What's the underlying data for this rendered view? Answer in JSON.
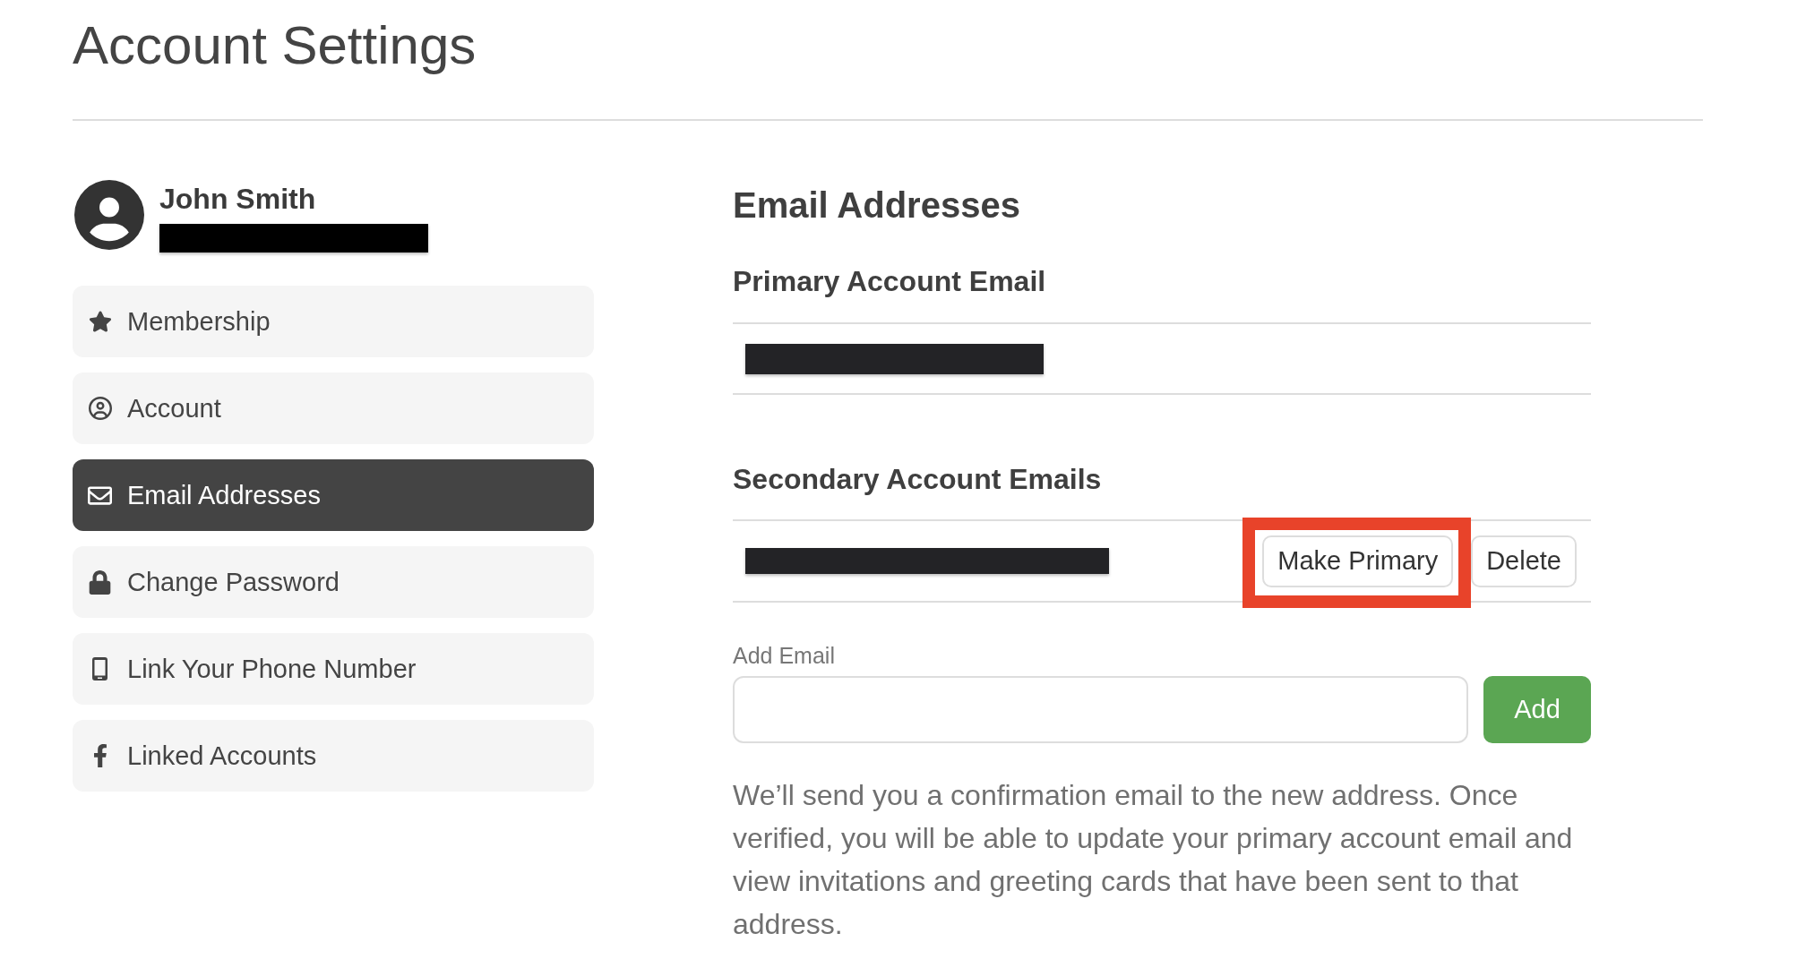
{
  "page": {
    "title": "Account Settings"
  },
  "profile": {
    "name": "John Smith",
    "email": {
      "redacted": true
    }
  },
  "sidebar": {
    "items": [
      {
        "label": "Membership",
        "selected": false
      },
      {
        "label": "Account",
        "selected": false
      },
      {
        "label": "Email Addresses",
        "selected": true
      },
      {
        "label": "Change Password",
        "selected": false
      },
      {
        "label": "Link Your Phone Number",
        "selected": false
      },
      {
        "label": "Linked Accounts",
        "selected": false
      }
    ]
  },
  "content": {
    "title": "Email Addresses",
    "primary": {
      "heading": "Primary Account Email",
      "email": {
        "redacted": true
      }
    },
    "secondary": {
      "heading": "Secondary Account Emails",
      "emails": [
        {
          "redacted": true,
          "actions": [
            {
              "label": "Make Primary",
              "highlighted": true
            },
            {
              "label": "Delete",
              "highlighted": false
            }
          ]
        }
      ]
    },
    "add_email": {
      "label": "Add Email",
      "button": "Add"
    },
    "note": "We’ll send you a confirmation email to the new address. Once verified, you will be able to update your primary account email and view invitations and greeting cards that have been sent to that address."
  }
}
